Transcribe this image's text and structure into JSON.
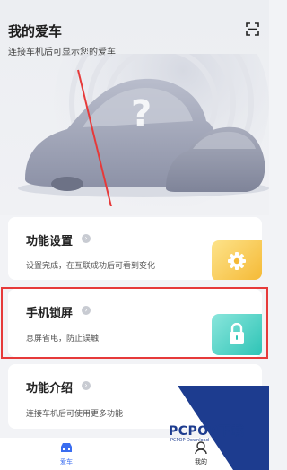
{
  "header": {
    "title": "我的爱车",
    "subtitle": "连接车机后可显示您的爱车",
    "scan_icon": "scan-icon"
  },
  "cards": [
    {
      "title": "功能设置",
      "desc": "设置完成，在互联成功后可看到变化",
      "icon": "gear-icon",
      "tile_color": "#f5b935"
    },
    {
      "title": "手机锁屏",
      "desc": "息屏省电，防止误触",
      "icon": "lock-icon",
      "tile_color": "#2ec4b6"
    },
    {
      "title": "功能介绍",
      "desc": "连接车机后可使用更多功能",
      "icon": "",
      "tile_color": ""
    }
  ],
  "tabbar": {
    "tabs": [
      {
        "label": "爱车",
        "icon": "car-icon",
        "active": true,
        "color": "#3a6df0"
      },
      {
        "label": "我的",
        "icon": "profile-icon",
        "active": false,
        "color": "#333333"
      }
    ]
  },
  "watermark": {
    "text": "PCPOP下载",
    "sub": "PCPOP Download"
  }
}
